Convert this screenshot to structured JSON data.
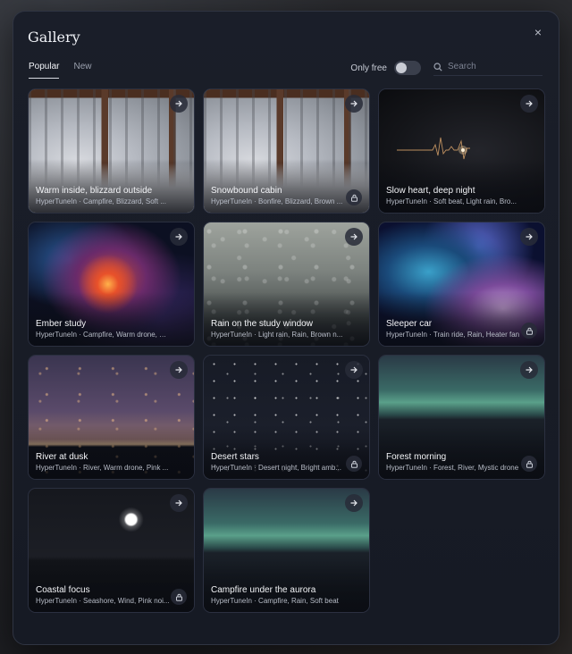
{
  "gallery": {
    "title": "Gallery",
    "close_symbol": "×",
    "tabs": [
      {
        "label": "Popular",
        "active": true
      },
      {
        "label": "New",
        "active": false
      }
    ],
    "only_free_label": "Only free",
    "only_free_on": false,
    "search_placeholder": "Search",
    "cards": [
      {
        "title": "Warm inside, blizzard outside",
        "subtitle": "HyperTuneIn · Campfire, Blizzard, Soft ...",
        "image": "snowy-window-image",
        "locked": false
      },
      {
        "title": "Snowbound cabin",
        "subtitle": "HyperTuneIn · Bonfire, Blizzard, Brown ...",
        "image": "snowy-window-image",
        "locked": true
      },
      {
        "title": "Slow heart, deep night",
        "subtitle": "HyperTuneIn · Soft beat, Light rain, Bro...",
        "image": "heartbeat-image",
        "locked": false
      },
      {
        "title": "Ember study",
        "subtitle": "HyperTuneIn · Campfire, Warm drone, B...",
        "image": "nebula-image",
        "locked": false
      },
      {
        "title": "Rain on the study window",
        "subtitle": "HyperTuneIn · Light rain, Rain, Brown n...",
        "image": "rain-glass-image",
        "locked": false
      },
      {
        "title": "Sleeper car",
        "subtitle": "HyperTuneIn · Train ride, Rain, Heater fan",
        "image": "space-nebula-image",
        "locked": true
      },
      {
        "title": "River at dusk",
        "subtitle": "HyperTuneIn · River, Warm drone, Pink ...",
        "image": "dusk-horizon-image",
        "locked": false
      },
      {
        "title": "Desert stars",
        "subtitle": "HyperTuneIn · Desert night, Bright amb...",
        "image": "starfield-image",
        "locked": true
      },
      {
        "title": "Forest morning",
        "subtitle": "HyperTuneIn · Forest, River, Mystic drone",
        "image": "aurora-image",
        "locked": true
      },
      {
        "title": "Coastal focus",
        "subtitle": "HyperTuneIn · Seashore, Wind, Pink noi...",
        "image": "moon-sea-image",
        "locked": true
      },
      {
        "title": "Campfire under the aurora",
        "subtitle": "HyperTuneIn · Campfire, Rain, Soft beat",
        "image": "aurora-image",
        "locked": false
      }
    ]
  },
  "colors": {
    "modal_bg": "#1a1e29",
    "accent_text": "#f1f3f7",
    "heartbeat": "#d9a36a"
  }
}
